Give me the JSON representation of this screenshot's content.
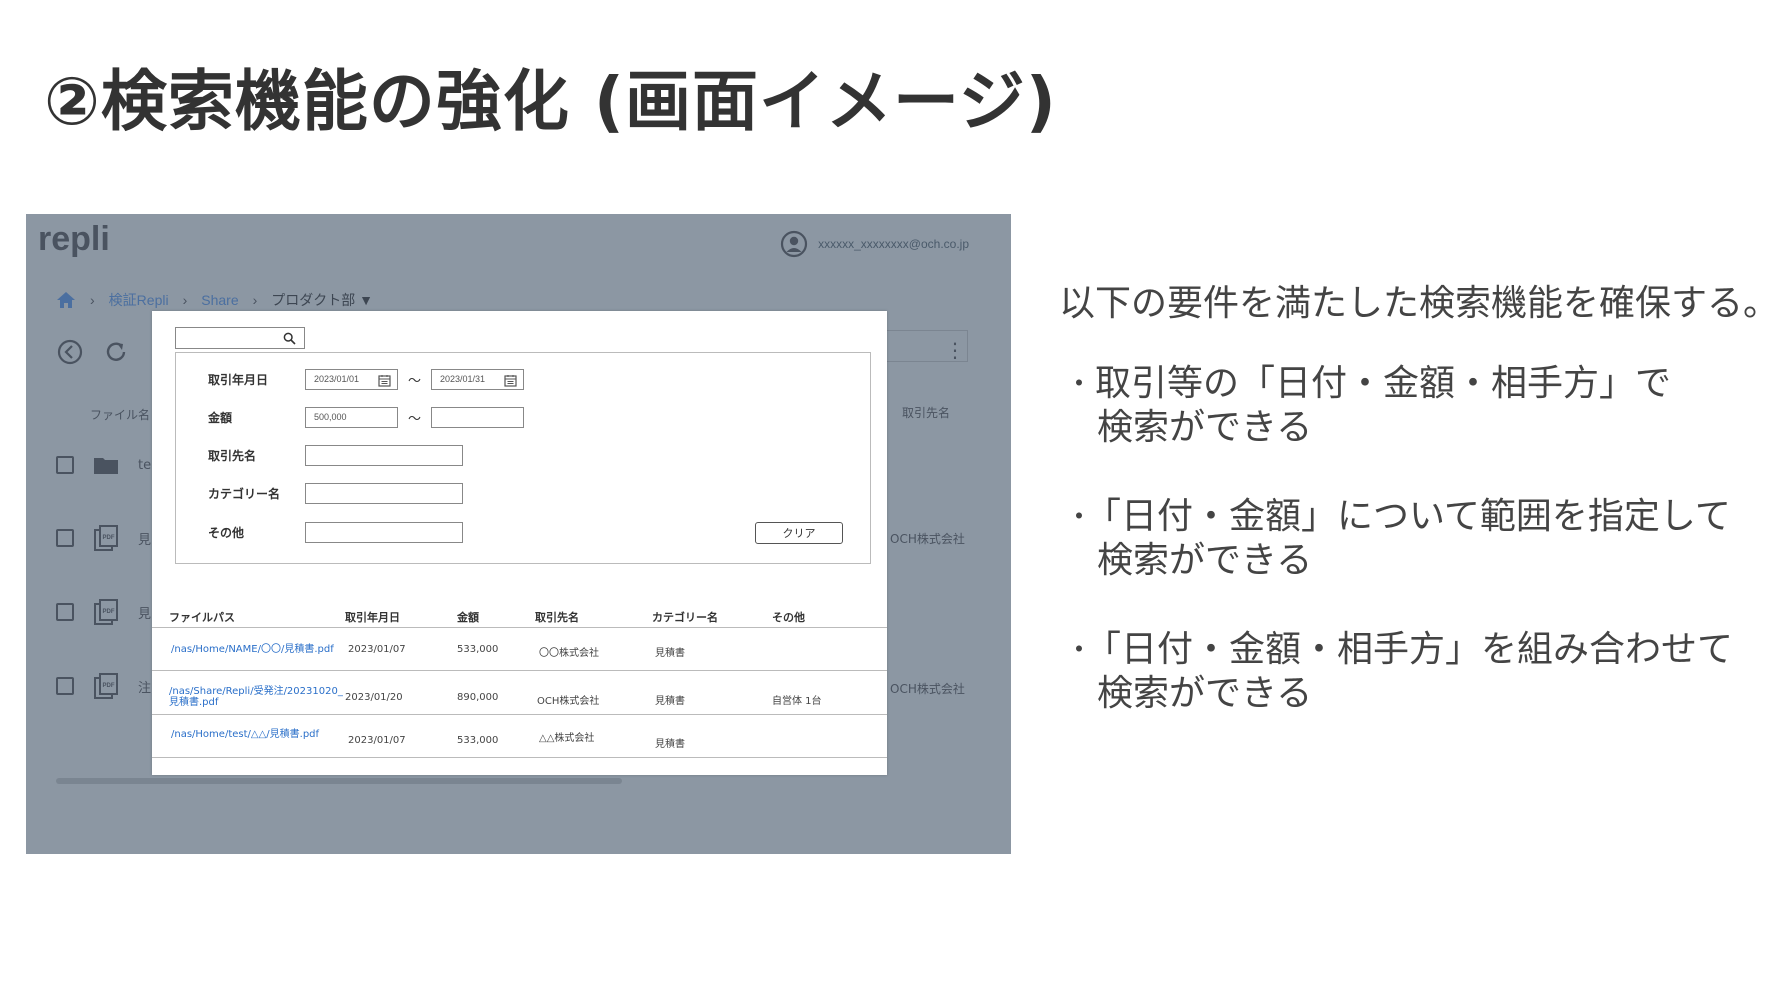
{
  "slide": {
    "title": "②検索機能の強化 (画面イメージ)"
  },
  "mock": {
    "logo": "repli",
    "user_email": "xxxxxx_xxxxxxxx@och.co.jp",
    "breadcrumb": [
      "検証Repli",
      "Share",
      "プロダクト部 ▼"
    ],
    "file_header": "ファイル名",
    "partner_header": "取引先名",
    "rows": [
      {
        "name": "te",
        "partner": ""
      },
      {
        "name": "見",
        "partner": "OCH株式会社"
      },
      {
        "name": "見",
        "partner": ""
      },
      {
        "name": "注",
        "partner": "OCH株式会社"
      }
    ],
    "modal": {
      "labels": {
        "date": "取引年月日",
        "amount": "金額",
        "partner": "取引先名",
        "category": "カテゴリー名",
        "other": "その他"
      },
      "date_from": "2023/01/01",
      "date_to": "2023/01/31",
      "amount_from": "500,000",
      "amount_to": "",
      "tilde": "〜",
      "clear_label": "クリア",
      "columns": [
        "ファイルパス",
        "取引年月日",
        "金額",
        "取引先名",
        "カテゴリー名",
        "その他"
      ],
      "results": [
        {
          "path": "/nas/Home/NAME/〇〇/見積書.pdf",
          "path2": "",
          "date": "2023/01/07",
          "amount": "533,000",
          "partner": "〇〇株式会社",
          "category": "見積書",
          "other": ""
        },
        {
          "path": "/nas/Share/Repli/受発注/20231020_",
          "path2": "見積書.pdf",
          "date": "2023/01/20",
          "amount": "890,000",
          "partner": "OCH株式会社",
          "category": "見積書",
          "other": "自営体 1台"
        },
        {
          "path": "/nas/Home/test/△△/見積書.pdf",
          "path2": "",
          "date": "2023/01/07",
          "amount": "533,000",
          "partner": "△△株式会社",
          "category": "見積書",
          "other": ""
        }
      ]
    }
  },
  "explanation": {
    "intro": "以下の要件を満たした検索機能を確保する。",
    "bullet_mark": "・",
    "bullets": [
      {
        "line1": "取引等の「日付・金額・相手方」で",
        "line2": "検索ができる"
      },
      {
        "line1": "「日付・金額」について範囲を指定して",
        "line2": "検索ができる"
      },
      {
        "line1": "「日付・金額・相手方」を組み合わせて",
        "line2": "検索ができる"
      }
    ]
  },
  "colors": {
    "overlay": "#8c97a3",
    "link": "#2a6fc9",
    "text": "#333333"
  },
  "icons": [
    "home-icon",
    "user-circle-icon",
    "back-icon",
    "refresh-icon",
    "folder-icon",
    "pdf-file-icon",
    "search-icon",
    "calendar-icon",
    "kebab-menu-icon"
  ]
}
